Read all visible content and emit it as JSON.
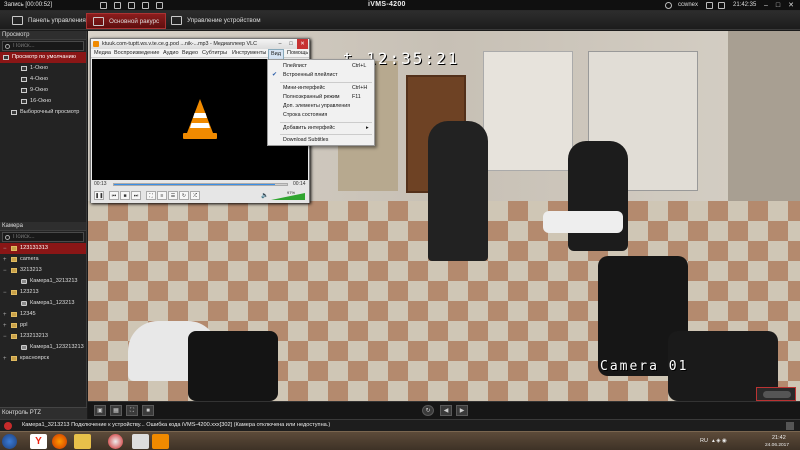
{
  "titlebar": {
    "recording": "Запись [00:00:52]",
    "title": "iVMS-4200",
    "user": "ccwnex",
    "clock": "21:42:35"
  },
  "nav": {
    "tabs": [
      {
        "label": "Панель управления"
      },
      {
        "label": "Основной ракурс"
      },
      {
        "label": "Управление устройством"
      }
    ]
  },
  "preview_panel": {
    "header": "Просмотр",
    "search_placeholder": "Поиск...",
    "items": [
      {
        "label": "Просмотр по умолчанию"
      },
      {
        "label": "1-Окно"
      },
      {
        "label": "4-Окно"
      },
      {
        "label": "9-Окно"
      },
      {
        "label": "16-Окно"
      },
      {
        "label": "Выборочный просмотр"
      }
    ]
  },
  "camera_panel": {
    "header": "Камера",
    "search_placeholder": "Поиск...",
    "items": [
      {
        "label": "123131313"
      },
      {
        "label": "camera"
      },
      {
        "label": "3213213"
      },
      {
        "label": "Камера1_3213213"
      },
      {
        "label": "123213"
      },
      {
        "label": "Камера1_123213"
      },
      {
        "label": "12345"
      },
      {
        "label": "ppl"
      },
      {
        "label": "123213213"
      },
      {
        "label": "Камера1_123213213"
      },
      {
        "label": "красноярск"
      }
    ]
  },
  "ptz_label": "Контроль PTZ",
  "video": {
    "timestamp": "t 12:35:21",
    "camera_name": "Camera 01"
  },
  "vlc": {
    "title": "ktuuk.com-tuptt.ws.v.te.ce.g.pod ...nik-...mp3 - Медиаплеер VLC",
    "menu": [
      "Медиа",
      "Воспроизведение",
      "Аудио",
      "Видео",
      "Субтитры",
      "Инструменты",
      "Вид",
      "Помощь"
    ],
    "time_elapsed": "00:13",
    "time_total": "00:14",
    "volume": "97%",
    "progress": 0.93
  },
  "view_menu": {
    "items": [
      {
        "label": "Плейлист",
        "shortcut": "Ctrl+L",
        "checked": false
      },
      {
        "label": "Встроенный плейлист",
        "shortcut": "",
        "checked": true
      },
      {
        "label": "Мини-интерфейс",
        "shortcut": "Ctrl+H",
        "checked": false
      },
      {
        "label": "Полноэкранный режим",
        "shortcut": "F11",
        "checked": false
      },
      {
        "label": "Доп. элементы управления",
        "shortcut": "",
        "checked": false
      },
      {
        "label": "Строка состояния",
        "shortcut": "",
        "checked": false
      },
      {
        "label": "Добавить интерфейс",
        "shortcut": "",
        "checked": false
      },
      {
        "label": "Download Subtitles",
        "shortcut": "",
        "checked": false
      }
    ]
  },
  "status": {
    "message": "Камера1_3213213 Подключение к устройству... Ошибка кода iVMS-4200.xxx[302] (Камера отключена или недоступна.)"
  },
  "taskbar": {
    "lang": "RU",
    "time": "21:42",
    "date": "24.06.2017"
  },
  "colors": {
    "accent": "#8a1616",
    "vlc_orange": "#f08a00"
  }
}
